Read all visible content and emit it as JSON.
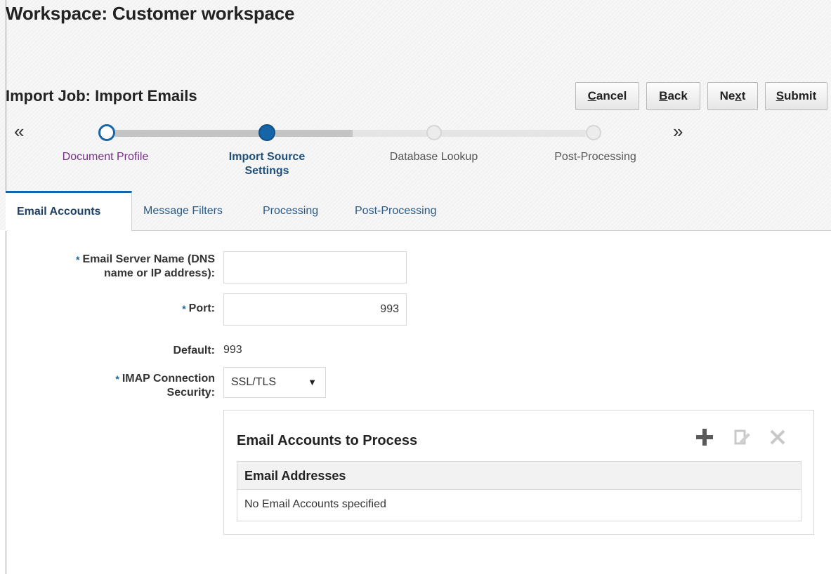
{
  "workspace": {
    "title": "Workspace: Customer workspace"
  },
  "job": {
    "title": "Import Job: Import Emails"
  },
  "buttons": {
    "cancel": {
      "mnemonic": "C",
      "rest": "ancel"
    },
    "back": {
      "mnemonic": "B",
      "rest": "ack"
    },
    "next": {
      "pre": "Ne",
      "mnemonic": "x",
      "post": "t"
    },
    "submit": {
      "mnemonic": "S",
      "rest": "ubmit"
    }
  },
  "train": {
    "prev_arrow": "«",
    "next_arrow": "»",
    "steps": [
      {
        "label": "Document Profile",
        "state": "visited"
      },
      {
        "label_line1": "Import Source",
        "label_line2": "Settings",
        "state": "current"
      },
      {
        "label": "Database Lookup",
        "state": "future"
      },
      {
        "label": "Post-Processing",
        "state": "future"
      }
    ]
  },
  "tabs": [
    {
      "label": "Email Accounts",
      "active": true
    },
    {
      "label": "Message Filters",
      "active": false
    },
    {
      "label": "Processing",
      "active": false
    },
    {
      "label": "Post-Processing",
      "active": false
    }
  ],
  "form": {
    "required_mark": "*",
    "server": {
      "label_line1": "Email Server Name (DNS",
      "label_line2": "name or IP address):",
      "value": ""
    },
    "port": {
      "label": "Port:",
      "value": "993"
    },
    "default": {
      "label": "Default:",
      "value": "993"
    },
    "security": {
      "label_line1": "IMAP Connection",
      "label_line2": "Security:",
      "value": "SSL/TLS",
      "caret": "▼"
    }
  },
  "accounts_panel": {
    "title": "Email Accounts to Process",
    "icons": [
      "add-icon",
      "edit-icon",
      "delete-icon"
    ],
    "column_header": "Email Addresses",
    "empty_message": "No Email Accounts specified"
  },
  "colors": {
    "accent": "#1565a8",
    "visited_step": "#7a2f8a",
    "tab_text": "#2a5a8a"
  }
}
